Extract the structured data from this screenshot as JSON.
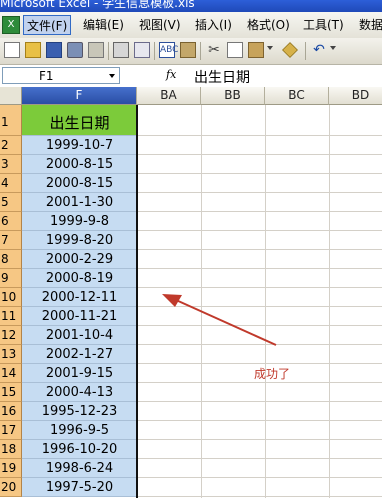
{
  "window": {
    "title": "Microsoft Excel - 学生信息模板.xls"
  },
  "menubar": {
    "items": [
      {
        "label": "文件(F)",
        "active": true
      },
      {
        "label": "编辑(E)"
      },
      {
        "label": "视图(V)"
      },
      {
        "label": "插入(I)"
      },
      {
        "label": "格式(O)"
      },
      {
        "label": "工具(T)"
      },
      {
        "label": "数据"
      }
    ]
  },
  "formula_bar": {
    "name_box": "F1",
    "fx": "fx",
    "content": "出生日期"
  },
  "grid": {
    "columns": [
      "F",
      "BA",
      "BB",
      "BC",
      "BD"
    ],
    "selected_column": "F",
    "rows": [
      "1",
      "2",
      "3",
      "4",
      "5",
      "6",
      "7",
      "8",
      "9",
      "10",
      "11",
      "12",
      "13",
      "14",
      "15",
      "16",
      "17",
      "18",
      "19",
      "20"
    ],
    "f_values": [
      "出生日期",
      "1999-10-7",
      "2000-8-15",
      "2000-8-15",
      "2001-1-30",
      "1999-9-8",
      "1999-8-20",
      "2000-2-29",
      "2000-8-19",
      "2000-12-11",
      "2000-11-21",
      "2001-10-4",
      "2002-1-27",
      "2001-9-15",
      "2000-4-13",
      "1995-12-23",
      "1996-9-5",
      "1996-10-20",
      "1998-6-24",
      "1997-5-20"
    ]
  },
  "annotation": {
    "text": "成功了",
    "color": "#c0392b"
  },
  "colors": {
    "header_cell": "#7ccb3a",
    "data_cell": "#c6dcf2",
    "row_header": "#f6c784",
    "selected_col": "#2a4ea5"
  }
}
